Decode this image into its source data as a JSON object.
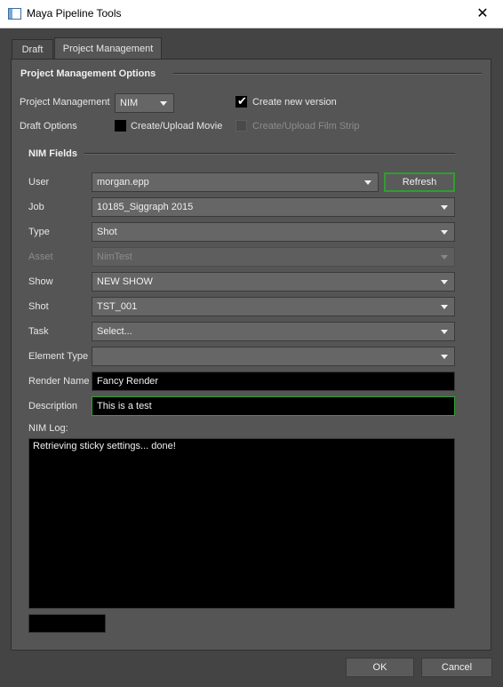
{
  "window": {
    "title": "Maya Pipeline Tools",
    "close_glyph": "✕"
  },
  "tabs": [
    {
      "label": "Draft",
      "active": false
    },
    {
      "label": "Project Management",
      "active": true
    }
  ],
  "options": {
    "section_title": "Project Management Options",
    "pm_label": "Project Management",
    "pm_value": "NIM",
    "create_version_label": "Create new version",
    "create_version_checked": true,
    "draft_options_label": "Draft Options",
    "upload_movie_label": "Create/Upload Movie",
    "upload_movie_checked": false,
    "film_strip_label": "Create/Upload Film Strip",
    "film_strip_enabled": false
  },
  "nim_fields": {
    "section_title": "NIM Fields",
    "user_label": "User",
    "user_value": "morgan.epp",
    "refresh_label": "Refresh",
    "job_label": "Job",
    "job_value": "10185_Siggraph 2015",
    "type_label": "Type",
    "type_value": "Shot",
    "asset_label": "Asset",
    "asset_value": "NimTest",
    "show_label": "Show",
    "show_value": "NEW SHOW",
    "shot_label": "Shot",
    "shot_value": "TST_001",
    "task_label": "Task",
    "task_value": "Select...",
    "element_type_label": "Element Type",
    "element_type_value": "",
    "render_name_label": "Render Name",
    "render_name_value": "Fancy Render",
    "description_label": "Description",
    "description_value": "This is a test",
    "log_label": "NIM Log:",
    "log_text": "Retrieving sticky settings... done!"
  },
  "footer": {
    "ok_label": "OK",
    "cancel_label": "Cancel"
  }
}
